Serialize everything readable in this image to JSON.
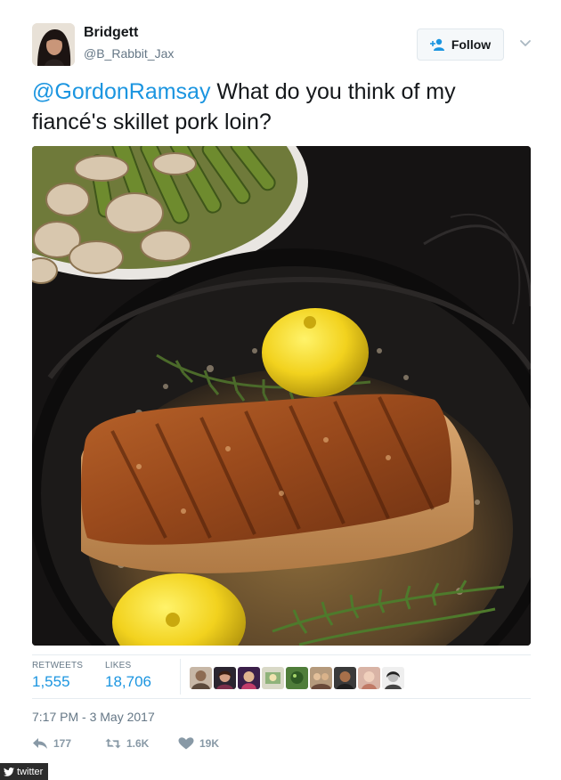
{
  "user": {
    "display_name": "Bridgett",
    "handle": "@B_Rabbit_Jax",
    "follow_label": "Follow"
  },
  "tweet": {
    "mention": "@GordonRamsay",
    "body": " What do you think of my fiancé's skillet pork loin?"
  },
  "stats": {
    "retweets_label": "RETWEETS",
    "retweets_value": "1,555",
    "likes_label": "LIKES",
    "likes_value": "18,706"
  },
  "timestamp": "7:17 PM - 3 May 2017",
  "actions": {
    "reply_count": "177",
    "retweet_count": "1.6K",
    "like_count": "19K"
  },
  "credit": "twitter",
  "colors": {
    "link": "#1b95e0",
    "muted": "#657786",
    "action_icon": "#8899a6"
  },
  "icons": [
    "add-user-icon",
    "chevron-down-icon",
    "reply-icon",
    "retweet-icon",
    "heart-icon",
    "twitter-bird-icon"
  ]
}
